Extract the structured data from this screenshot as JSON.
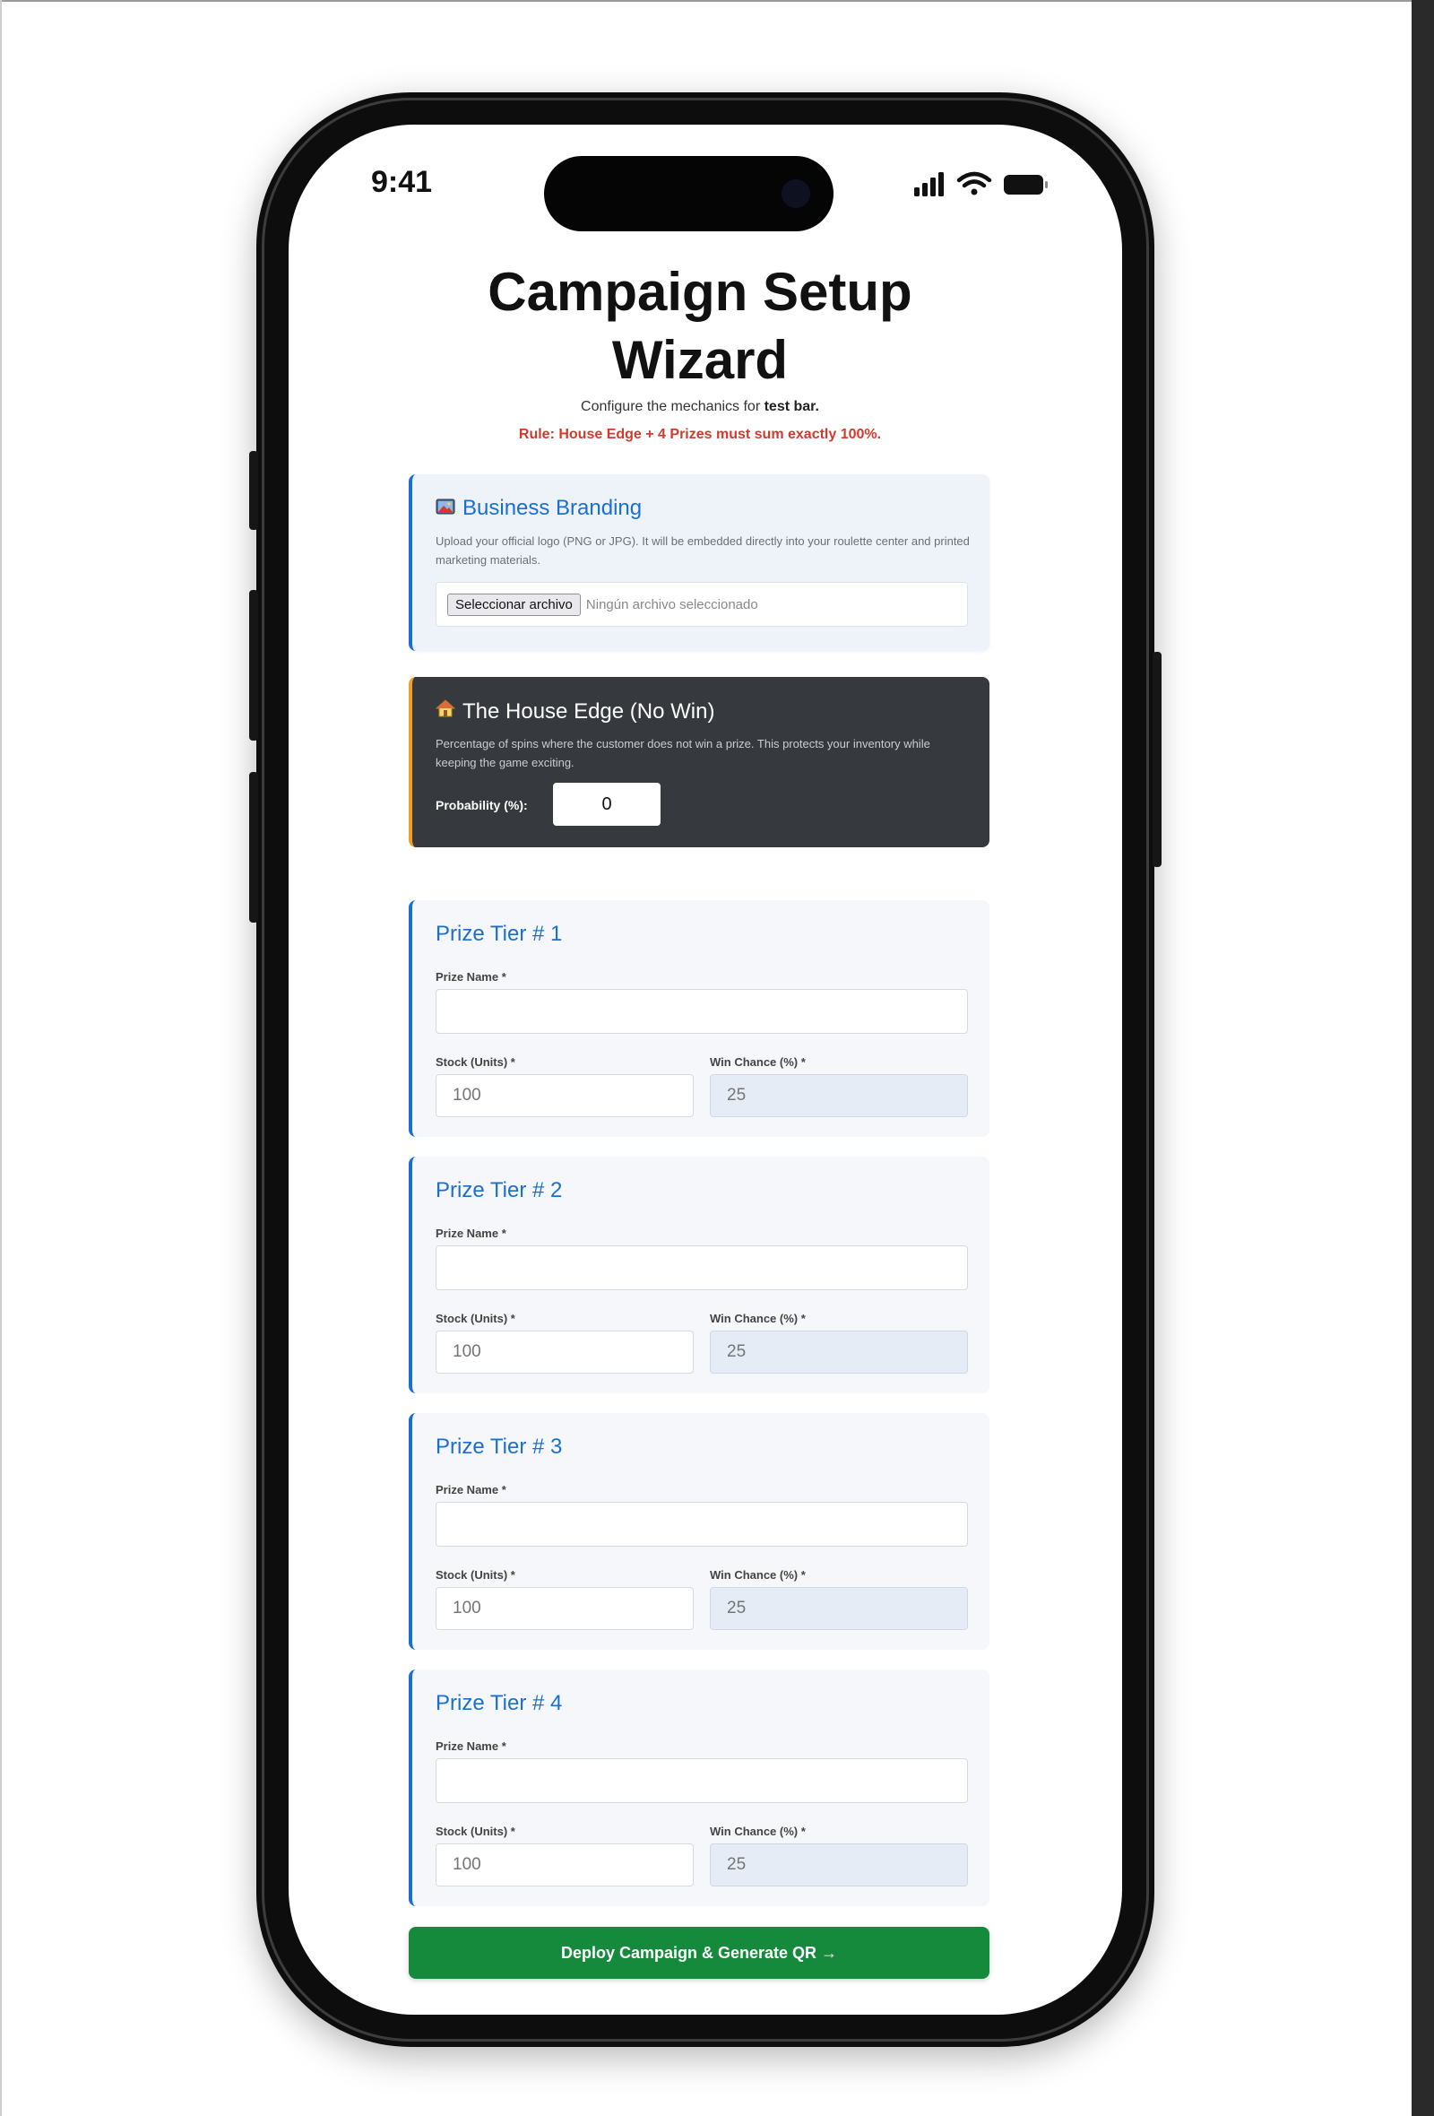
{
  "status": {
    "time": "9:41"
  },
  "page": {
    "title": "Campaign Setup Wizard",
    "subtitle_prefix": "Configure the mechanics for ",
    "subtitle_bold": "test bar.",
    "rule": "Rule: House Edge + 4 Prizes must sum exactly 100%."
  },
  "branding": {
    "icon": "image-icon",
    "title": "Business Branding",
    "description": "Upload your official logo (PNG or JPG). It will be embedded directly into your roulette center and printed marketing materials.",
    "file_button": "Seleccionar archivo",
    "file_status": "Ningún archivo seleccionado"
  },
  "house": {
    "icon": "house-icon",
    "title": "The House Edge (No Win)",
    "description": "Percentage of spins where the customer does not win a prize. This protects your inventory while keeping the game exciting.",
    "probability_label": "Probability (%):",
    "probability_value": "0"
  },
  "tiers": [
    {
      "title": "Prize Tier # 1",
      "name_label": "Prize Name *",
      "name_value": "",
      "stock_label": "Stock (Units) *",
      "stock_placeholder": "100",
      "chance_label": "Win Chance (%) *",
      "chance_placeholder": "25"
    },
    {
      "title": "Prize Tier # 2",
      "name_label": "Prize Name *",
      "name_value": "",
      "stock_label": "Stock (Units) *",
      "stock_placeholder": "100",
      "chance_label": "Win Chance (%) *",
      "chance_placeholder": "25"
    },
    {
      "title": "Prize Tier # 3",
      "name_label": "Prize Name *",
      "name_value": "",
      "stock_label": "Stock (Units) *",
      "stock_placeholder": "100",
      "chance_label": "Win Chance (%) *",
      "chance_placeholder": "25"
    },
    {
      "title": "Prize Tier # 4",
      "name_label": "Prize Name *",
      "name_value": "",
      "stock_label": "Stock (Units) *",
      "stock_placeholder": "100",
      "chance_label": "Win Chance (%) *",
      "chance_placeholder": "25"
    }
  ],
  "deploy_button": "Deploy Campaign & Generate QR →",
  "colors": {
    "accent_blue": "#1a6fd1",
    "house_accent": "#f0a020",
    "rule_red": "#d33a2c",
    "deploy_green": "#168a3c",
    "house_bg": "#36393d"
  }
}
